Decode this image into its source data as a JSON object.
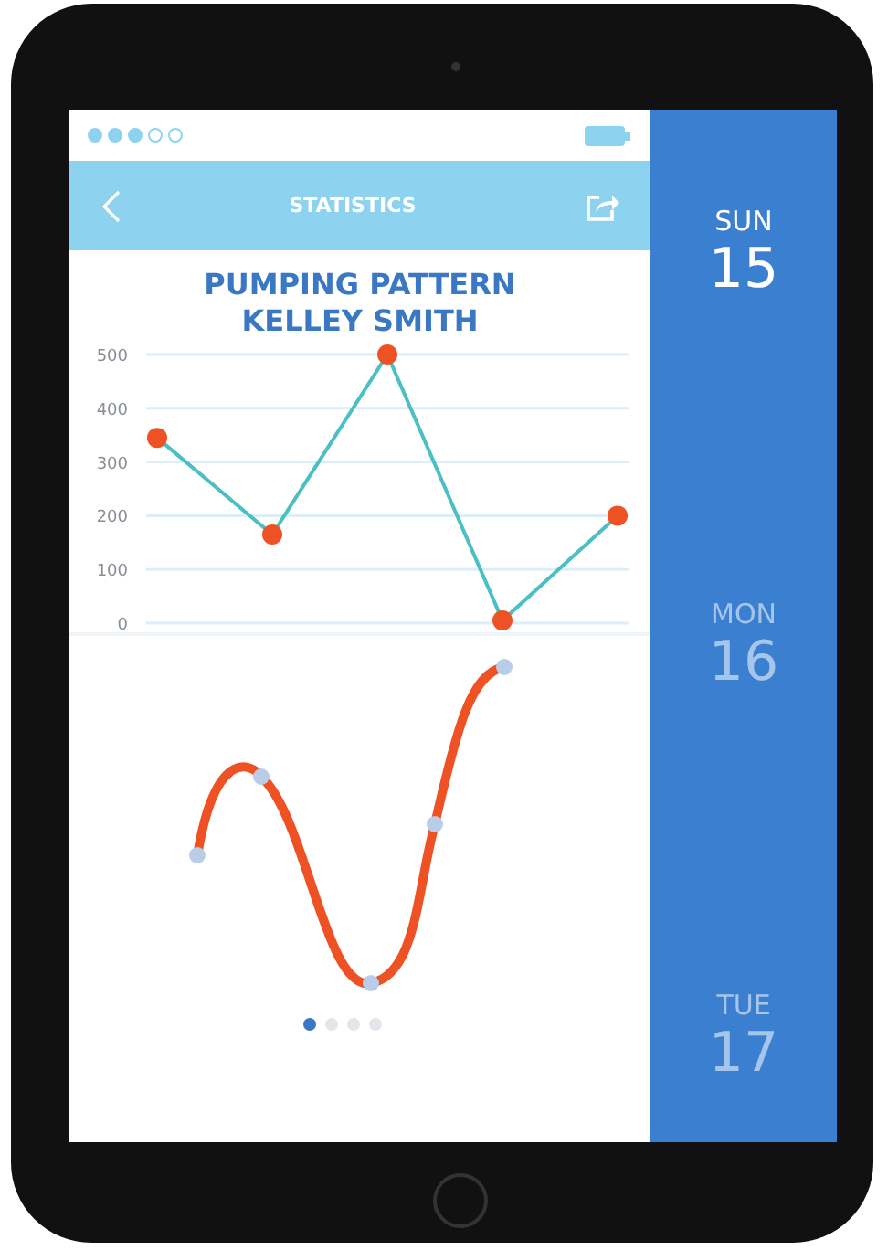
{
  "status_bar": {
    "signal_dots": [
      {
        "filled": true
      },
      {
        "filled": true
      },
      {
        "filled": true
      },
      {
        "filled": false
      },
      {
        "filled": false
      }
    ]
  },
  "nav_bar": {
    "title": "STATISTICS"
  },
  "heading": [
    "PUMPING PATTERN",
    "KELLEY SMITH"
  ],
  "chart_data": {
    "type": "line",
    "grid": true,
    "ylim": [
      0,
      500
    ],
    "yticks": [
      0,
      100,
      200,
      300,
      400,
      500
    ],
    "series": [
      {
        "color": "#4bbfc4",
        "marker": true,
        "values": [
          345,
          165,
          500,
          5,
          200
        ]
      }
    ]
  },
  "pager": [
    {
      "selected": true
    },
    {
      "selected": false
    },
    {
      "selected": false
    },
    {
      "selected": false
    }
  ],
  "days": [
    {
      "weekday": "SUN",
      "date": "15",
      "selected": true
    },
    {
      "weekday": "MON",
      "date": "16",
      "selected": false
    },
    {
      "weekday": "TUE",
      "date": "17",
      "selected": false
    }
  ]
}
